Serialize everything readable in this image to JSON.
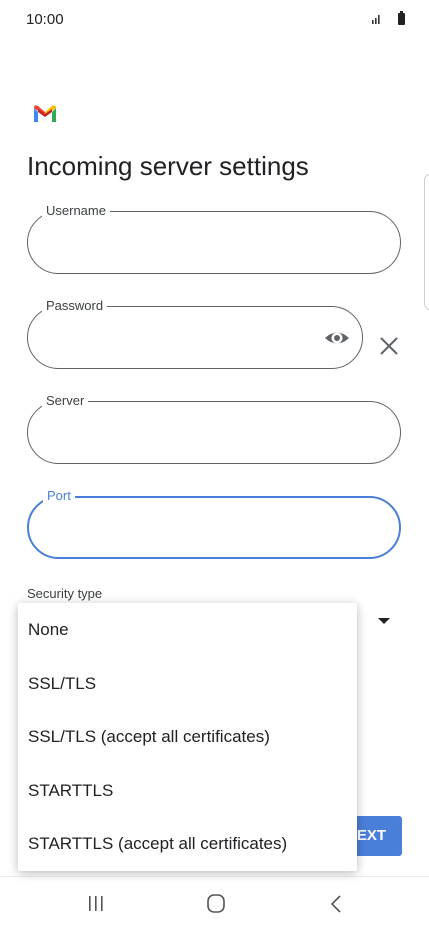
{
  "status_bar": {
    "time": "10:00",
    "icons": [
      "signal-icon",
      "battery-icon"
    ]
  },
  "header": {
    "logo": "gmail-logo-icon",
    "title": "Incoming server settings"
  },
  "form": {
    "username": {
      "label": "Username",
      "value": ""
    },
    "password": {
      "label": "Password",
      "value": "",
      "show_icon": "eye-icon",
      "clear_icon": "close-icon"
    },
    "server": {
      "label": "Server",
      "value": ""
    },
    "port": {
      "label": "Port",
      "value": "",
      "focused": true
    },
    "security_type": {
      "label": "Security type",
      "arrow_icon": "dropdown-arrow-icon"
    }
  },
  "security_menu": {
    "options": [
      "None",
      "SSL/TLS",
      "SSL/TLS (accept all certificates)",
      "STARTTLS",
      "STARTTLS (accept all certificates)"
    ]
  },
  "next_button": {
    "label": "NEXT"
  },
  "nav_bar": {
    "buttons": [
      "recent-apps-icon",
      "home-icon",
      "back-icon"
    ]
  },
  "colors": {
    "accent": "#4a7fd9",
    "text": "#202124",
    "outline": "#5f6368"
  }
}
